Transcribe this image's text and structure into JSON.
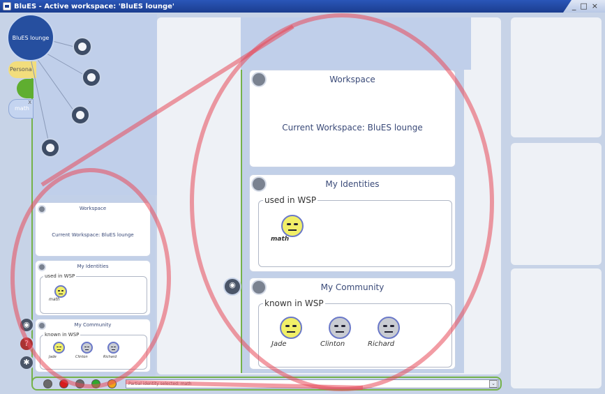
{
  "window": {
    "title": "BluES - Active workspace: 'BluES lounge'",
    "controls": [
      "_",
      "□",
      "×"
    ]
  },
  "hub": {
    "label": "BluES lounge"
  },
  "side_tabs": {
    "personal": "Persona",
    "math": "math",
    "math_close": "X"
  },
  "small": {
    "workspace": {
      "title": "Workspace",
      "text": "Current Workspace: BluES lounge"
    },
    "identities": {
      "title": "My Identities",
      "legend": "used in WSP",
      "face_label": "math"
    },
    "community": {
      "title": "My Community",
      "legend": "known in WSP",
      "members": [
        "Jade",
        "Clinton",
        "Richard"
      ]
    }
  },
  "big": {
    "workspace": {
      "title": "Workspace",
      "text": "Current Workspace: BluES lounge"
    },
    "identities": {
      "title": "My Identities",
      "legend": "used in WSP",
      "face_label": "math"
    },
    "community": {
      "title": "My Community",
      "legend": "known in WSP",
      "members": [
        "Jade",
        "Clinton",
        "Richard"
      ]
    }
  },
  "status": {
    "text": "Partial identity selected: math",
    "dropdown": "⌄"
  },
  "side_icons": [
    "◉",
    "?",
    "✱"
  ],
  "colors": {
    "accent_green": "#74b24a",
    "titlebar": "#1b3d8f",
    "highlight": "#e84a5a"
  }
}
